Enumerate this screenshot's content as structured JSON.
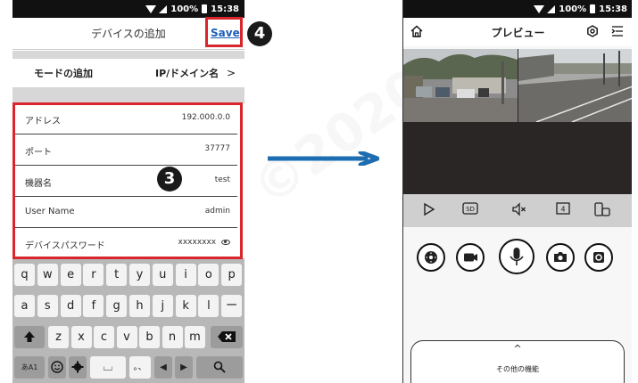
{
  "statusbar": {
    "battery": "100%",
    "time": "15:38"
  },
  "left_screen": {
    "header_title": "デバイスの追加",
    "save_label": "Save",
    "mode_row": {
      "label": "モードの追加",
      "value": "IP/ドメイン名",
      "chevron": ">"
    },
    "fields": [
      {
        "label": "アドレス",
        "value": "192.000.0.0"
      },
      {
        "label": "ポート",
        "value": "37777"
      },
      {
        "label": "機器名",
        "value": "test"
      },
      {
        "label": "User Name",
        "value": "admin"
      },
      {
        "label": "デバイスパスワード",
        "value": "xxxxxxxx"
      }
    ],
    "badges": {
      "three": "3",
      "four": "4"
    },
    "keyboard": {
      "row1": [
        "q",
        "w",
        "e",
        "r",
        "t",
        "y",
        "u",
        "i",
        "o",
        "p"
      ],
      "row2": [
        "a",
        "s",
        "d",
        "f",
        "g",
        "h",
        "j",
        "k",
        "l",
        "ー"
      ],
      "row3": [
        "z",
        "x",
        "c",
        "v",
        "b",
        "n",
        "m"
      ],
      "bottom": {
        "lang": "あA1",
        "space": "⌴",
        "punct": "。、",
        "left": "◀",
        "right": "▶",
        "search": "⚲"
      }
    }
  },
  "right_screen": {
    "header_title": "プレビュー",
    "more_caret": "^",
    "more_label": "その他の機能"
  },
  "colors": {
    "highlight": "#d9262c",
    "arrow": "#1e6db0",
    "save_link": "#1b5eb8"
  }
}
